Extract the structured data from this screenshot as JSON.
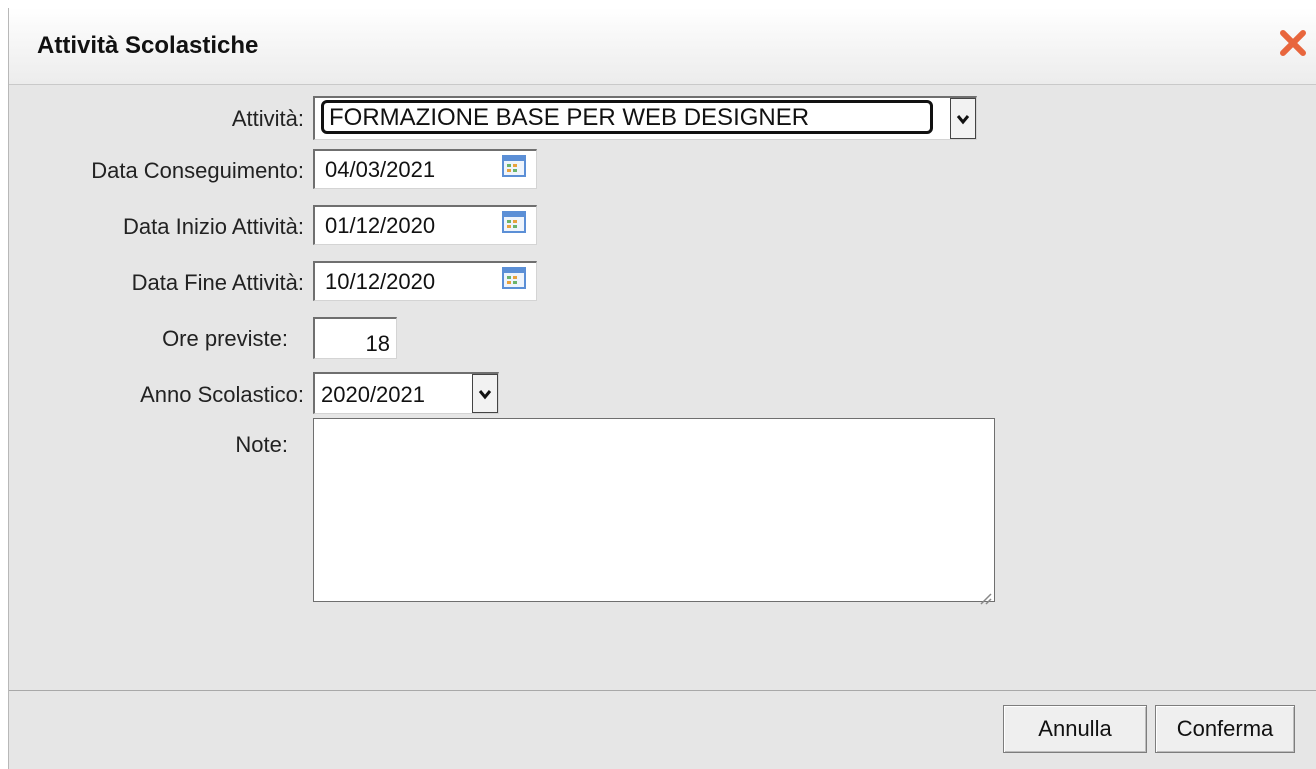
{
  "dialog": {
    "title": "Attività Scolastiche",
    "close_icon": "close-icon"
  },
  "form": {
    "attivita_label": "Attività:",
    "attivita_value": "FORMAZIONE BASE PER WEB DESIGNER",
    "data_conseguimento_label": "Data Conseguimento:",
    "data_conseguimento_value": "04/03/2021",
    "data_inizio_label": "Data Inizio Attività:",
    "data_inizio_value": "01/12/2020",
    "data_fine_label": "Data Fine Attività:",
    "data_fine_value": "10/12/2020",
    "ore_previste_label": "Ore previste:",
    "ore_previste_value": "18",
    "anno_scolastico_label": "Anno Scolastico:",
    "anno_scolastico_value": "2020/2021",
    "note_label": "Note:",
    "note_value": ""
  },
  "footer": {
    "cancel_label": "Annulla",
    "confirm_label": "Conferma"
  },
  "colors": {
    "close_icon": "#e8663d",
    "calendar_icon": "#5b8fd6"
  }
}
